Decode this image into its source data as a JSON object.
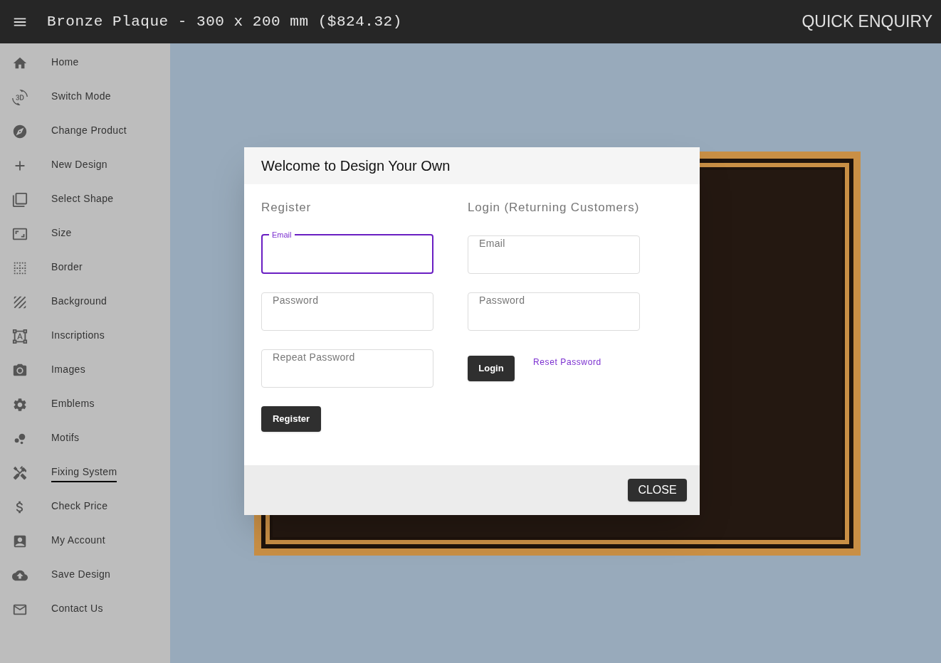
{
  "header": {
    "title": "Bronze Plaque - 300 x 200 mm ($824.32)",
    "action": "QUICK ENQUIRY"
  },
  "sidebar": {
    "items": [
      {
        "label": "Home",
        "selected": false
      },
      {
        "label": "Switch Mode",
        "selected": false
      },
      {
        "label": "Change Product",
        "selected": false
      },
      {
        "label": "New Design",
        "selected": false
      },
      {
        "label": "Select Shape",
        "selected": false
      },
      {
        "label": "Size",
        "selected": false
      },
      {
        "label": "Border",
        "selected": false
      },
      {
        "label": "Background",
        "selected": false
      },
      {
        "label": "Inscriptions",
        "selected": false
      },
      {
        "label": "Images",
        "selected": false
      },
      {
        "label": "Emblems",
        "selected": false
      },
      {
        "label": "Motifs",
        "selected": false
      },
      {
        "label": "Fixing System",
        "selected": true
      },
      {
        "label": "Check Price",
        "selected": false
      },
      {
        "label": "My Account",
        "selected": false
      },
      {
        "label": "Save Design",
        "selected": false
      },
      {
        "label": "Contact Us",
        "selected": false
      }
    ]
  },
  "dialog": {
    "title": "Welcome to Design Your Own",
    "register": {
      "heading": "Register",
      "fields": [
        {
          "label": "Email",
          "focused": true
        },
        {
          "label": "Password",
          "focused": false
        },
        {
          "label": "Repeat Password",
          "focused": false
        }
      ],
      "button": "Register"
    },
    "login": {
      "heading": "Login (Returning Customers)",
      "fields": [
        {
          "label": "Email",
          "focused": false
        },
        {
          "label": "Password",
          "focused": false
        }
      ],
      "button": "Login",
      "link": "Reset Password"
    },
    "close": "CLOSE"
  }
}
